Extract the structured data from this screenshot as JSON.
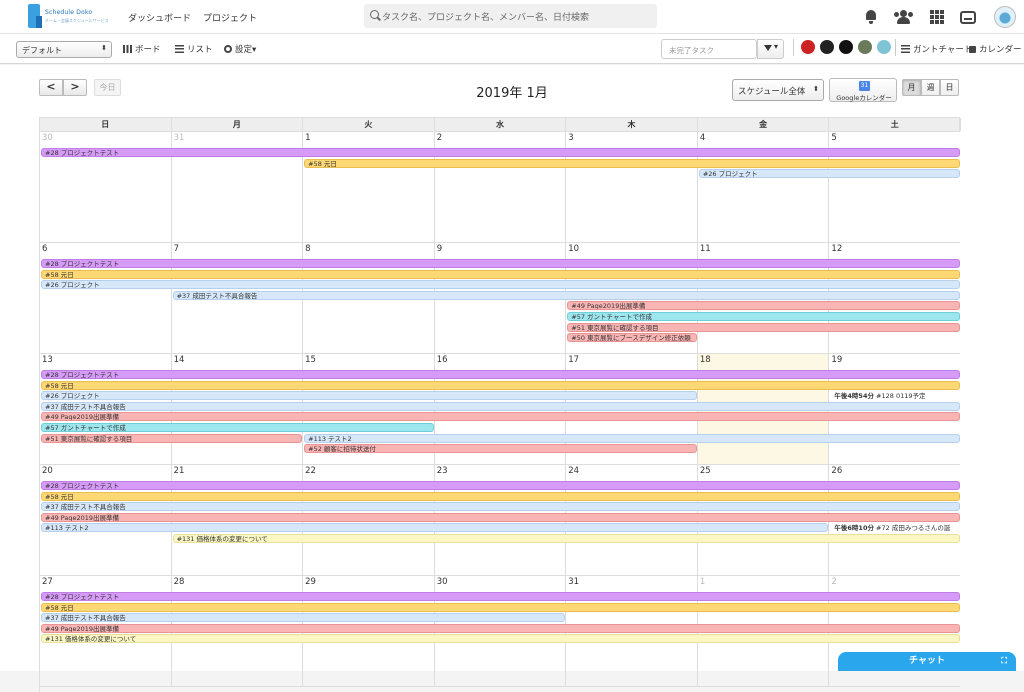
{
  "app": {
    "logo_title": "Schedule Doko",
    "logo_subtitle": "チーム・会議スケジュールサービス",
    "nav": [
      "ダッシュボード",
      "プロジェクト"
    ],
    "search_placeholder": "タスク名、プロジェクト名、メンバー名、日付検索"
  },
  "toolbar": {
    "preset": "デフォルト",
    "board": "ボード",
    "list": "リスト",
    "settings": "設定",
    "filter_placeholder": "未完了タスク",
    "gantt": "ガントチャート",
    "calendar": "カレンダー"
  },
  "calendar": {
    "today": "今日",
    "prev": "<",
    "next": ">",
    "title": "2019年 1月",
    "schedule_select": "スケジュール全体",
    "google_cal_icon": "31",
    "google_cal": "Googleカレンダー",
    "views": [
      "月",
      "週",
      "日"
    ],
    "weekdays": [
      "日",
      "月",
      "火",
      "水",
      "木",
      "金",
      "土"
    ],
    "weeks": [
      {
        "days": [
          "30",
          "31",
          "1",
          "2",
          "3",
          "4",
          "5"
        ],
        "other": [
          0,
          1
        ],
        "events": [
          {
            "text": "#28 プロジェクトテスト",
            "start": 0,
            "end": 6,
            "row": 0,
            "color": "purple"
          },
          {
            "text": "#58 元日",
            "start": 2,
            "end": 6,
            "row": 1,
            "color": "yellow"
          },
          {
            "text": "#26 プロジェクト",
            "start": 5,
            "end": 6,
            "row": 2,
            "color": "lblue"
          }
        ]
      },
      {
        "days": [
          "6",
          "7",
          "8",
          "9",
          "10",
          "11",
          "12"
        ],
        "other": [],
        "events": [
          {
            "text": "#28 プロジェクトテスト",
            "start": 0,
            "end": 6,
            "row": 0,
            "color": "purple"
          },
          {
            "text": "#58 元日",
            "start": 0,
            "end": 6,
            "row": 1,
            "color": "yellow"
          },
          {
            "text": "#26 プロジェクト",
            "start": 0,
            "end": 6,
            "row": 2,
            "color": "lblue"
          },
          {
            "text": "#37 成田テスト不具合報告",
            "start": 1,
            "end": 6,
            "row": 3,
            "color": "lblue"
          },
          {
            "text": "#49 Page2019出展準備",
            "start": 4,
            "end": 6,
            "row": 4,
            "color": "pink"
          },
          {
            "text": "#57 ガントチャートで作成",
            "start": 4,
            "end": 6,
            "row": 5,
            "color": "cyan"
          },
          {
            "text": "#51 東京展覧に確認する項目",
            "start": 4,
            "end": 6,
            "row": 6,
            "color": "pink"
          },
          {
            "text": "#50 東京展覧にブースデザイン修正依頼",
            "start": 4,
            "end": 4,
            "row": 7,
            "color": "pink"
          }
        ]
      },
      {
        "days": [
          "13",
          "14",
          "15",
          "16",
          "17",
          "18",
          "19"
        ],
        "other": [],
        "highlight": 5,
        "events": [
          {
            "text": "#28 プロジェクトテスト",
            "start": 0,
            "end": 6,
            "row": 0,
            "color": "purple"
          },
          {
            "text": "#58 元日",
            "start": 0,
            "end": 6,
            "row": 1,
            "color": "yellow"
          },
          {
            "text": "#26 プロジェクト",
            "start": 0,
            "end": 4,
            "row": 2,
            "color": "lblue"
          },
          {
            "text": "#37 成田テスト不具合報告",
            "start": 0,
            "end": 6,
            "row": 3,
            "color": "lblue"
          },
          {
            "text": "#49 Page2019出展準備",
            "start": 0,
            "end": 6,
            "row": 4,
            "color": "pink"
          },
          {
            "text": "#57 ガントチャートで作成",
            "start": 0,
            "end": 2,
            "row": 5,
            "color": "cyan"
          },
          {
            "text": "#51 東京展覧に確認する項目",
            "start": 0,
            "end": 1,
            "row": 6,
            "color": "pink"
          },
          {
            "text": "#113 テスト2",
            "start": 2,
            "end": 6,
            "row": 6,
            "color": "lblue"
          },
          {
            "text": "#52 顧客に招待状送付",
            "start": 2,
            "end": 4,
            "row": 7,
            "color": "pink"
          }
        ],
        "timed": [
          {
            "time": "午後4時54分",
            "text": " #128 0119予定",
            "col": 6,
            "row": 2
          }
        ]
      },
      {
        "days": [
          "20",
          "21",
          "22",
          "23",
          "24",
          "25",
          "26"
        ],
        "other": [],
        "events": [
          {
            "text": "#28 プロジェクトテスト",
            "start": 0,
            "end": 6,
            "row": 0,
            "color": "purple"
          },
          {
            "text": "#58 元日",
            "start": 0,
            "end": 6,
            "row": 1,
            "color": "yellow"
          },
          {
            "text": "#37 成田テスト不具合報告",
            "start": 0,
            "end": 6,
            "row": 2,
            "color": "lblue"
          },
          {
            "text": "#49 Page2019出展準備",
            "start": 0,
            "end": 6,
            "row": 3,
            "color": "pink"
          },
          {
            "text": "#113 テスト2",
            "start": 0,
            "end": 5,
            "row": 4,
            "color": "lblue"
          },
          {
            "text": "#131 価格体系の変更について",
            "start": 1,
            "end": 6,
            "row": 5,
            "color": "lyellow"
          }
        ],
        "timed": [
          {
            "time": "午後6時10分",
            "text": " #72 成田みつるさんの誕",
            "col": 6,
            "row": 4
          }
        ]
      },
      {
        "days": [
          "27",
          "28",
          "29",
          "30",
          "31",
          "1",
          "2"
        ],
        "other": [
          5,
          6
        ],
        "events": [
          {
            "text": "#28 プロジェクトテスト",
            "start": 0,
            "end": 6,
            "row": 0,
            "color": "purple"
          },
          {
            "text": "#58 元日",
            "start": 0,
            "end": 6,
            "row": 1,
            "color": "yellow"
          },
          {
            "text": "#37 成田テスト不具合報告",
            "start": 0,
            "end": 3,
            "row": 2,
            "color": "lblue"
          },
          {
            "text": "#49 Page2019出展準備",
            "start": 0,
            "end": 6,
            "row": 3,
            "color": "pink"
          },
          {
            "text": "#131 価格体系の変更について",
            "start": 0,
            "end": 6,
            "row": 4,
            "color": "lyellow"
          }
        ]
      }
    ]
  },
  "chat": {
    "label": "チャット",
    "expand_icon": "⛶"
  },
  "members": [
    {
      "color": "#cc2222"
    },
    {
      "color": "#222222"
    },
    {
      "color": "#111111"
    },
    {
      "color": "#6a7a5a"
    },
    {
      "color": "#7fc4d6"
    }
  ]
}
